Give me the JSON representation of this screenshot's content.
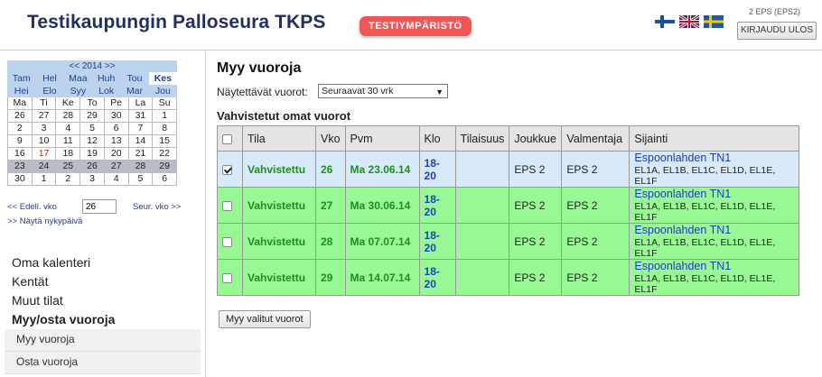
{
  "header": {
    "title": "Testikaupungin Palloseura TKPS",
    "env_badge": "TESTIYMPÄRISTÖ",
    "user": "2 EPS (EPS2)",
    "logout": "KIRJAUDU ULOS",
    "languages": [
      "fi",
      "en",
      "sv"
    ]
  },
  "calendar": {
    "year_nav": "<< 2014 >>",
    "months": [
      "Tam",
      "Hel",
      "Maa",
      "Huh",
      "Tou",
      "Kes",
      "Hei",
      "Elo",
      "Syy",
      "Lok",
      "Mar",
      "Jou"
    ],
    "active_month": "Kes",
    "weekdays": [
      "Ma",
      "Ti",
      "Ke",
      "To",
      "Pe",
      "La",
      "Su"
    ],
    "weeks": [
      [
        "26",
        "27",
        "28",
        "29",
        "30",
        "31",
        "1"
      ],
      [
        "2",
        "3",
        "4",
        "5",
        "6",
        "7",
        "8"
      ],
      [
        "9",
        "10",
        "11",
        "12",
        "13",
        "14",
        "15"
      ],
      [
        "16",
        "17",
        "18",
        "19",
        "20",
        "21",
        "22"
      ],
      [
        "23",
        "24",
        "25",
        "26",
        "27",
        "28",
        "29"
      ],
      [
        "30",
        "1",
        "2",
        "3",
        "4",
        "5",
        "6"
      ]
    ],
    "highlight_day": "17",
    "selected_week_index": 4,
    "prev_week": "<< Edell. vko",
    "week_value": "26",
    "next_week": "Seur. vko >>",
    "show_today": ">> Näytä nykypäivä"
  },
  "side_menu": {
    "items": [
      "Oma kalenteri",
      "Kentät",
      "Muut tilat",
      "Myy/osta vuoroja"
    ],
    "sub_items": [
      "Myy vuoroja",
      "Osta vuoroja"
    ]
  },
  "main": {
    "title": "Myy vuoroja",
    "filter_label": "Näytettävät vuorot:",
    "filter_value": "Seuraavat 30 vrk",
    "section_title": "Vahvistetut omat vuorot",
    "sell_button": "Myy valitut vuorot"
  },
  "table": {
    "headers": [
      "Tila",
      "Vko",
      "Pvm",
      "Klo",
      "Tilaisuus",
      "Joukkue",
      "Valmentaja",
      "Sijainti"
    ],
    "rows": [
      {
        "checked": true,
        "status": "Vahvistettu",
        "week": "26",
        "date": "Ma 23.06.14",
        "time": "18-20",
        "event": "",
        "team": "EPS 2",
        "coach": "EPS 2",
        "location": "Espoonlahden TN1",
        "fields": "EL1A, EL1B, EL1C, EL1D, EL1E, EL1F"
      },
      {
        "checked": false,
        "status": "Vahvistettu",
        "week": "27",
        "date": "Ma 30.06.14",
        "time": "18-20",
        "event": "",
        "team": "EPS 2",
        "coach": "EPS 2",
        "location": "Espoonlahden TN1",
        "fields": "EL1A, EL1B, EL1C, EL1D, EL1E, EL1F"
      },
      {
        "checked": false,
        "status": "Vahvistettu",
        "week": "28",
        "date": "Ma 07.07.14",
        "time": "18-20",
        "event": "",
        "team": "EPS 2",
        "coach": "EPS 2",
        "location": "Espoonlahden TN1",
        "fields": "EL1A, EL1B, EL1C, EL1D, EL1E, EL1F"
      },
      {
        "checked": false,
        "status": "Vahvistettu",
        "week": "29",
        "date": "Ma 14.07.14",
        "time": "18-20",
        "event": "",
        "team": "EPS 2",
        "coach": "EPS 2",
        "location": "Espoonlahden TN1",
        "fields": "EL1A, EL1B, EL1C, EL1D, EL1E, EL1F"
      }
    ]
  },
  "colors": {
    "title": "#23305f",
    "badge": "#f25757",
    "selected_row": "#d8e9f9",
    "confirmed_row": "#98f894",
    "status_text": "#1f8f1f",
    "link": "#1d3ec0"
  }
}
